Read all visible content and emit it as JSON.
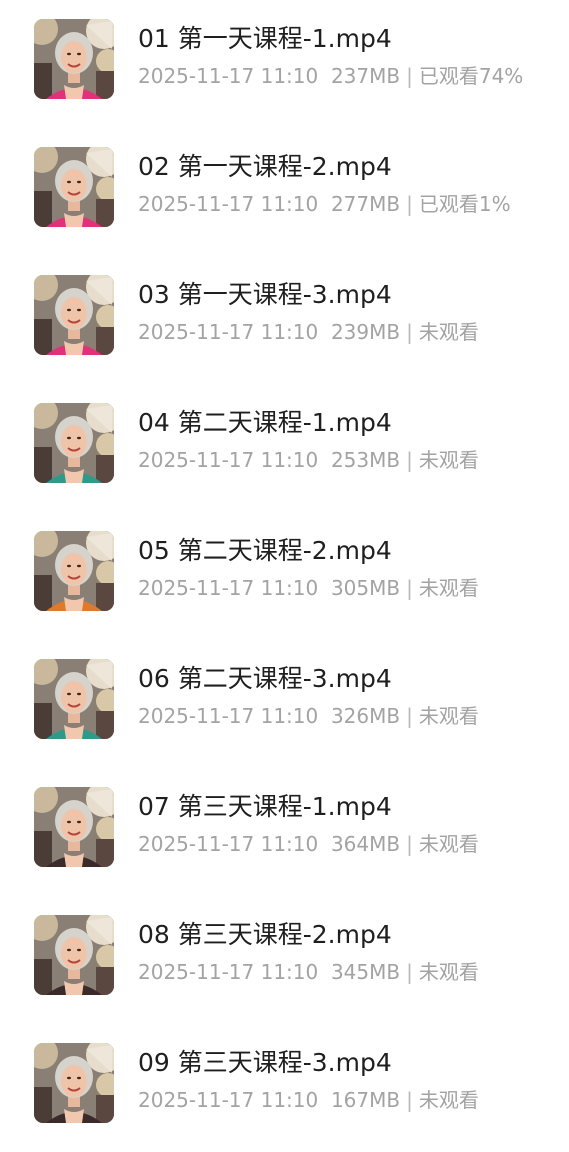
{
  "files": [
    {
      "name": "01 第一天课程-1.mp4",
      "date": "2025-11-17 11:10",
      "size": "237MB",
      "status": "已观看74%",
      "thumbnail": "video-thumbnail-woman"
    },
    {
      "name": "02 第一天课程-2.mp4",
      "date": "2025-11-17 11:10",
      "size": "277MB",
      "status": "已观看1%",
      "thumbnail": "video-thumbnail-woman"
    },
    {
      "name": "03 第一天课程-3.mp4",
      "date": "2025-11-17 11:10",
      "size": "239MB",
      "status": "未观看",
      "thumbnail": "video-thumbnail-woman"
    },
    {
      "name": "04 第二天课程-1.mp4",
      "date": "2025-11-17 11:10",
      "size": "253MB",
      "status": "未观看",
      "thumbnail": "video-thumbnail-woman"
    },
    {
      "name": "05 第二天课程-2.mp4",
      "date": "2025-11-17 11:10",
      "size": "305MB",
      "status": "未观看",
      "thumbnail": "video-thumbnail-woman"
    },
    {
      "name": "06 第二天课程-3.mp4",
      "date": "2025-11-17 11:10",
      "size": "326MB",
      "status": "未观看",
      "thumbnail": "video-thumbnail-woman"
    },
    {
      "name": "07 第三天课程-1.mp4",
      "date": "2025-11-17 11:10",
      "size": "364MB",
      "status": "未观看",
      "thumbnail": "video-thumbnail-woman"
    },
    {
      "name": "08 第三天课程-2.mp4",
      "date": "2025-11-17 11:10",
      "size": "345MB",
      "status": "未观看",
      "thumbnail": "video-thumbnail-woman"
    },
    {
      "name": "09 第三天课程-3.mp4",
      "date": "2025-11-17 11:10",
      "size": "167MB",
      "status": "未观看",
      "thumbnail": "video-thumbnail-woman"
    }
  ],
  "separator": "|",
  "colors": {
    "title": "#1f1f1f",
    "meta": "#a3a3a3",
    "background": "#ffffff",
    "scarf_pink": "#e2317a",
    "scarf_green": "#2f9a8a",
    "scarf_orange": "#e07a2a",
    "scarf_dark": "#3a2a2a"
  }
}
